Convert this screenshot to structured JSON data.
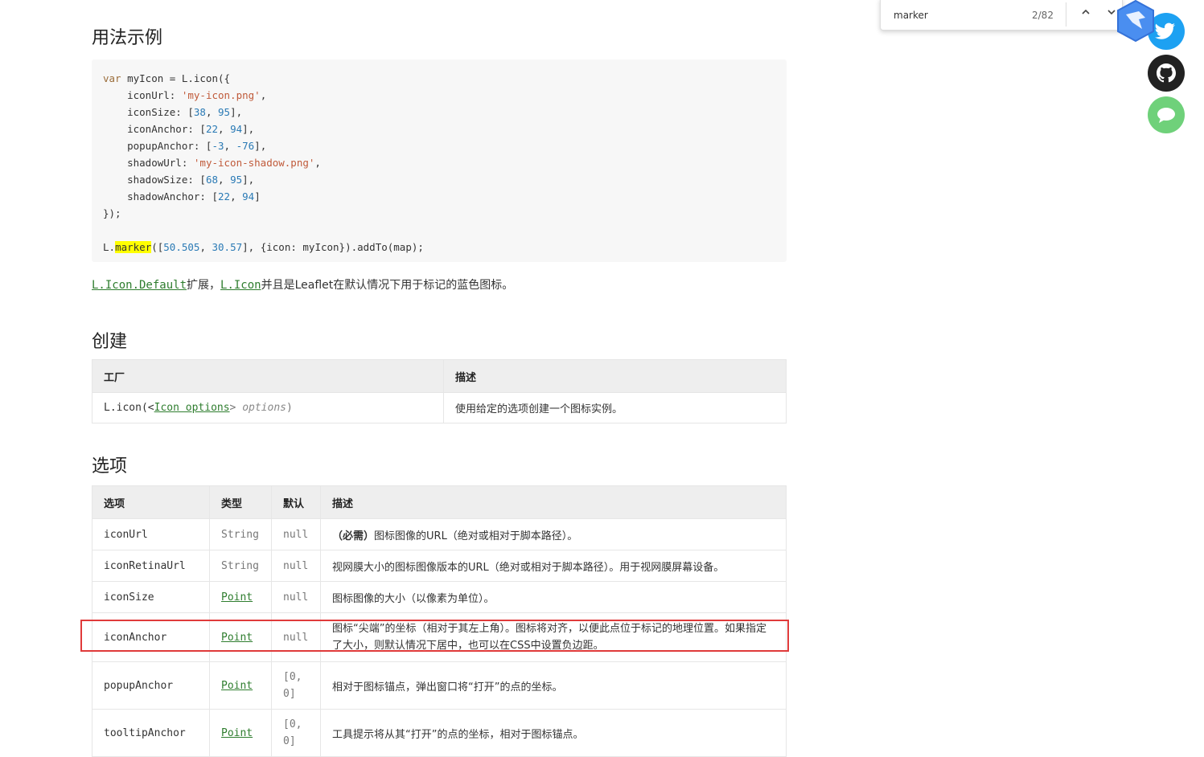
{
  "sections": {
    "usage_title": "用法示例",
    "create_title": "创建",
    "options_title": "选项"
  },
  "description": {
    "link1": "L.Icon.Default",
    "text1": "扩展，",
    "link2": "L.Icon",
    "text2": "并且是Leaflet在默认情况下用于标记的蓝色图标。"
  },
  "create_table": {
    "headers": [
      "工厂",
      "描述"
    ],
    "row": {
      "prefix": "L.icon(<",
      "link": "Icon options",
      "mid": "> ",
      "param": "options",
      "suffix": ")",
      "desc": "使用给定的选项创建一个图标实例。"
    }
  },
  "options_table": {
    "headers": [
      "选项",
      "类型",
      "默认",
      "描述"
    ],
    "rows": [
      {
        "option": "iconUrl",
        "type": "String",
        "default": "null",
        "desc_bold": "（必需）",
        "desc": "图标图像的URL（绝对或相对于脚本路径）。"
      },
      {
        "option": "iconRetinaUrl",
        "type": "String",
        "default": "null",
        "desc_bold": "",
        "desc": "视网膜大小的图标图像版本的URL（绝对或相对于脚本路径）。用于视网膜屏幕设备。"
      },
      {
        "option": "iconSize",
        "type": "Point",
        "default": "null",
        "desc_bold": "",
        "desc": "图标图像的大小（以像素为单位）。"
      },
      {
        "option": "iconAnchor",
        "type": "Point",
        "default": "null",
        "desc_bold": "",
        "desc": "图标“尖端”的坐标（相对于其左上角）。图标将对齐，以便此点位于标记的地理位置。如果指定了大小，则默认情况下居中，也可以在CSS中设置负边距。"
      },
      {
        "option": "popupAnchor",
        "type": "Point",
        "default": "[0, 0]",
        "desc_bold": "",
        "desc": "相对于图标锚点，弹出窗口将“打开”的点的坐标。"
      },
      {
        "option": "tooltipAnchor",
        "type": "Point",
        "default": "[0, 0]",
        "desc_bold": "",
        "desc": "工具提示将从其“打开”的点的坐标，相对于图标锚点。"
      }
    ]
  },
  "find_bar": {
    "query": "marker",
    "count": "2/82",
    "prev_icon": "chevron-up-icon",
    "next_icon": "chevron-down-icon"
  },
  "side_buttons": [
    "bird-app-icon",
    "twitter-icon",
    "github-icon",
    "chat-icon"
  ],
  "colors": {
    "link": "#2e7d2e",
    "highlight": "#ffff00",
    "red_box": "#e03a3a",
    "twitter": "#1da1f2",
    "chat": "#6fd17a"
  }
}
